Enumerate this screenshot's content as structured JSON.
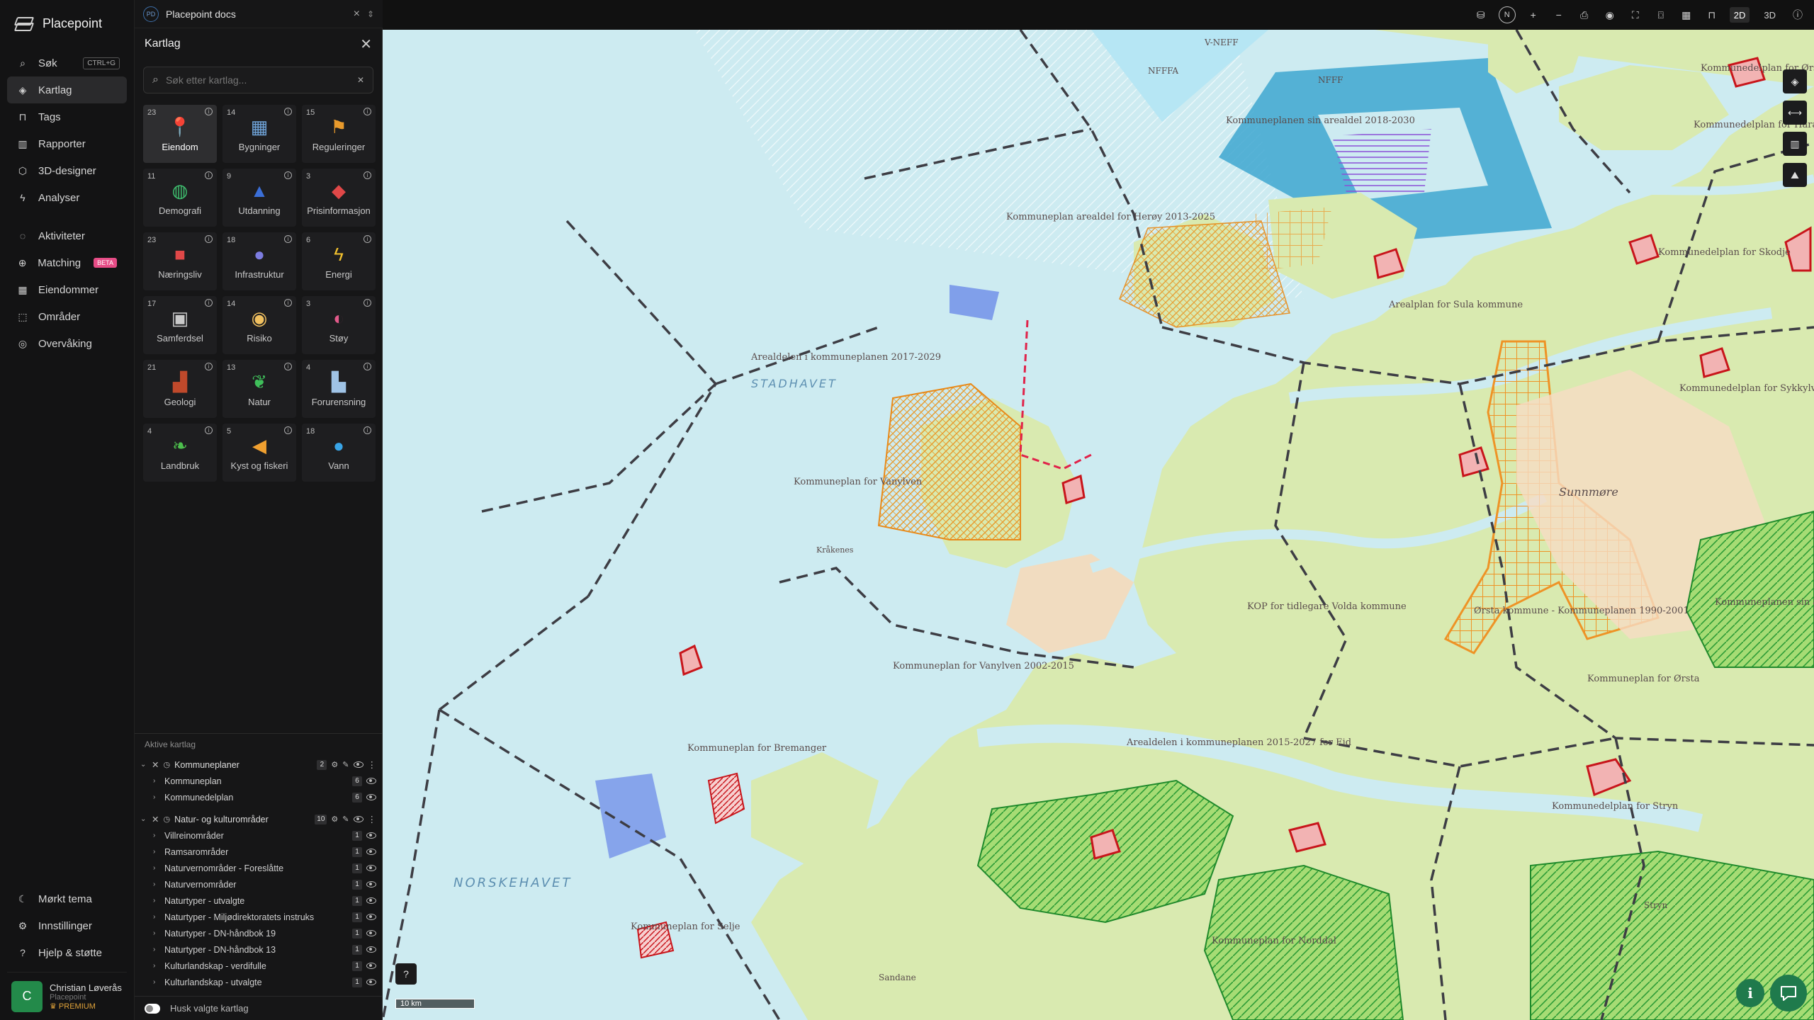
{
  "app": {
    "name": "Placepoint"
  },
  "nav": {
    "items": [
      {
        "label": "Søk",
        "icon": "search-icon",
        "shortcut": "CTRL+G"
      },
      {
        "label": "Kartlag",
        "icon": "layers-icon",
        "active": true
      },
      {
        "label": "Tags",
        "icon": "bookmark-icon"
      },
      {
        "label": "Rapporter",
        "icon": "chart-icon"
      },
      {
        "label": "3D-designer",
        "icon": "cube-icon"
      },
      {
        "label": "Analyser",
        "icon": "bolt-icon"
      },
      {
        "label": "Aktiviteter",
        "icon": "activity-icon"
      },
      {
        "label": "Matching",
        "icon": "match-icon",
        "badge": "BETA"
      },
      {
        "label": "Eiendommer",
        "icon": "grid-icon"
      },
      {
        "label": "Områder",
        "icon": "area-icon"
      },
      {
        "label": "Overvåking",
        "icon": "monitor-icon"
      }
    ],
    "bottom": [
      {
        "label": "Mørkt tema",
        "icon": "moon-icon"
      },
      {
        "label": "Innstillinger",
        "icon": "gear-icon"
      },
      {
        "label": "Hjelp & støtte",
        "icon": "help-icon"
      }
    ],
    "user": {
      "initial": "C",
      "name": "Christian Løverås",
      "org": "Placepoint",
      "plan": "PREMIUM"
    }
  },
  "tab": {
    "badge": "PD",
    "title": "Placepoint docs"
  },
  "panel": {
    "title": "Kartlag",
    "search_placeholder": "Søk etter kartlag...",
    "categories": [
      {
        "count": "23",
        "label": "Eiendom",
        "icon": "pin-icon",
        "active": true
      },
      {
        "count": "14",
        "label": "Bygninger",
        "icon": "building-icon"
      },
      {
        "count": "15",
        "label": "Reguleringer",
        "icon": "signpost-icon"
      },
      {
        "count": "11",
        "label": "Demografi",
        "icon": "people-icon"
      },
      {
        "count": "9",
        "label": "Utdanning",
        "icon": "graduation-icon"
      },
      {
        "count": "3",
        "label": "Prisinformasjon",
        "icon": "shopping-bag-icon"
      },
      {
        "count": "23",
        "label": "Næringsliv",
        "icon": "briefcase-icon"
      },
      {
        "count": "18",
        "label": "Infrastruktur",
        "icon": "globe-icon"
      },
      {
        "count": "6",
        "label": "Energi",
        "icon": "lightning-icon"
      },
      {
        "count": "17",
        "label": "Samferdsel",
        "icon": "bus-icon"
      },
      {
        "count": "14",
        "label": "Risiko",
        "icon": "hazard-icon"
      },
      {
        "count": "3",
        "label": "Støy",
        "icon": "gauge-icon"
      },
      {
        "count": "21",
        "label": "Geologi",
        "icon": "terrain-icon"
      },
      {
        "count": "13",
        "label": "Natur",
        "icon": "leaf-icon"
      },
      {
        "count": "4",
        "label": "Forurensning",
        "icon": "factory-icon"
      },
      {
        "count": "4",
        "label": "Landbruk",
        "icon": "sprout-icon"
      },
      {
        "count": "5",
        "label": "Kyst og fiskeri",
        "icon": "fish-icon"
      },
      {
        "count": "18",
        "label": "Vann",
        "icon": "water-drop-icon"
      }
    ],
    "active_title": "Aktive kartlag",
    "groups": [
      {
        "name": "Kommuneplaner",
        "count": "2",
        "items": [
          {
            "name": "Kommuneplan",
            "count": "6"
          },
          {
            "name": "Kommunedelplan",
            "count": "6"
          }
        ]
      },
      {
        "name": "Natur- og kulturområder",
        "count": "10",
        "items": [
          {
            "name": "Villreinområder",
            "count": "1"
          },
          {
            "name": "Ramsarområder",
            "count": "1"
          },
          {
            "name": "Naturvernområder - Foreslåtte",
            "count": "1"
          },
          {
            "name": "Naturvernområder",
            "count": "1"
          },
          {
            "name": "Naturtyper - utvalgte",
            "count": "1"
          },
          {
            "name": "Naturtyper - Miljødirektoratets instruks",
            "count": "1"
          },
          {
            "name": "Naturtyper - DN-håndbok 19",
            "count": "1"
          },
          {
            "name": "Naturtyper - DN-håndbok 13",
            "count": "1"
          },
          {
            "name": "Kulturlandskap - verdifulle",
            "count": "1"
          },
          {
            "name": "Kulturlandskap - utvalgte",
            "count": "1"
          }
        ]
      }
    ],
    "remember_label": "Husk valgte kartlag"
  },
  "toolbar": {
    "north": "N",
    "plus": "+",
    "minus": "−",
    "mode2d": "2D",
    "mode3d": "3D"
  },
  "map": {
    "labels": [
      "NFFFA",
      "Kommuneplanen sin arealdel 2018-2030",
      "Kommunedelplan for Haram",
      "Kommunedelplan for Skodje",
      "Kommuneplan arealdel for Herøy 2013-2025",
      "Arealdelen i kommuneplanen 2017-2029",
      "Kommunedelplan for Sykkylven",
      "Kommunedelplan for Ørskog",
      "Arealplan for Sula kommune",
      "KOP for tidlegare Volda kommune",
      "Ørsta kommune - Kommuneplanen 1990-2001",
      "Kommuneplan for Vanylven",
      "Kommuneplan for Vanylven 2002-2015",
      "Arealdelen i kommuneplanen 2015-2027 for Eid",
      "Kommuneplan for Bremanger",
      "Kommunedelplan for Stryn",
      "Kommuneplan for Ørsta",
      "Kommuneplan for Norddal",
      "Kommuneplanen sin arealdel",
      "Kommuneplan for Selje",
      "NFFF",
      "V-NEFF",
      "Sunnmøre",
      "Kråkenes",
      "Stryn",
      "Sandane"
    ],
    "sea_labels": [
      "STADHAVET",
      "NORSKEHAVET"
    ],
    "scale": "10 km"
  },
  "colors": {
    "accent": "#1f7a4c",
    "sea": "#cdebf1",
    "land": "#d9eab0",
    "plan_orange": "#f0a030",
    "plan_red": "#d01c1c",
    "nature_green": "#39b54a"
  }
}
